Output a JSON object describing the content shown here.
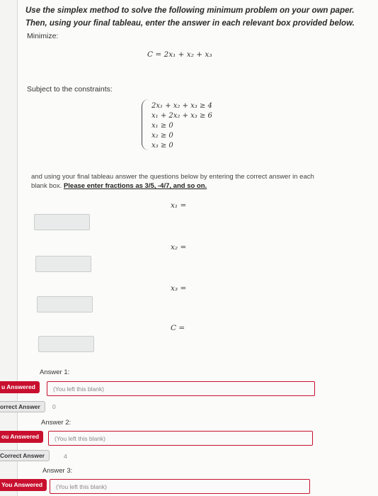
{
  "prompt": "Use the simplex method to solve the following minimum problem on your own paper. Then, using your final tableau, enter the answer in each relevant box provided below.",
  "minimize_label": "Minimize:",
  "objective": "C = 2x₁ + x₂ + x₃",
  "constraints_label": "Subject to the constraints:",
  "constraints": [
    "2x₁ + x₂ + x₃ ≥ 4",
    "x₁ + 2x₂ + x₃ ≥ 6",
    "x₁ ≥ 0",
    "x₂ ≥ 0",
    "x₃ ≥ 0"
  ],
  "instructions": "and using your final tableau answer the questions below by entering the correct answer in each blank box.",
  "instructions_emphasis": "Please enter fractions as 3/5, -4/7, and so on.",
  "blanks": [
    {
      "label": "x₁ ="
    },
    {
      "label": "x₂ ="
    },
    {
      "label": "x₃ ="
    },
    {
      "label": "C ="
    }
  ],
  "answers": [
    {
      "title": "Answer 1:",
      "badge": "u Answered",
      "value": "(You left this blank)",
      "correct_badge": "orrect Answer",
      "correct": "0"
    },
    {
      "title": "Answer 2:",
      "badge": "ou Answered",
      "value": "(You left this blank)",
      "correct_badge": "Correct Answer",
      "correct": "4"
    },
    {
      "title": "Answer 3:",
      "badge": "You Answered",
      "value": "(You left this blank)"
    }
  ]
}
